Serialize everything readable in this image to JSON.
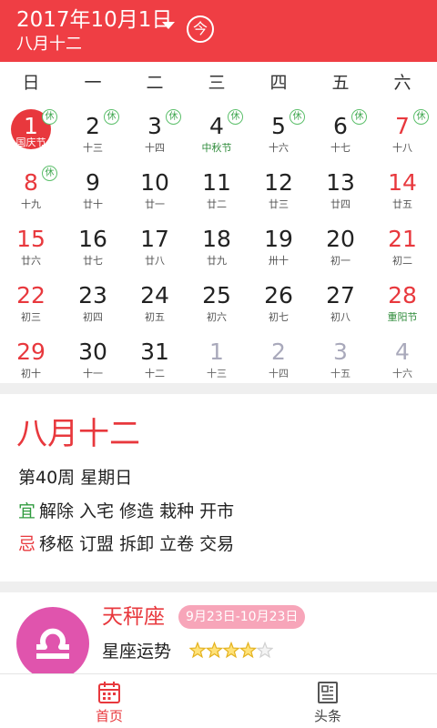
{
  "header": {
    "date": "2017年10月1日",
    "lunar": "八月十二",
    "today_label": "今",
    "color": "#ef3e44"
  },
  "weekdays": [
    "日",
    "一",
    "二",
    "三",
    "四",
    "五",
    "六"
  ],
  "rest_mark": "休",
  "days": [
    {
      "n": "1",
      "l": "国庆节",
      "rest": true,
      "weekend": true,
      "sel": true
    },
    {
      "n": "2",
      "l": "十三",
      "rest": true
    },
    {
      "n": "3",
      "l": "十四",
      "rest": true
    },
    {
      "n": "4",
      "l": "中秋节",
      "rest": true,
      "fest": true
    },
    {
      "n": "5",
      "l": "十六",
      "rest": true
    },
    {
      "n": "6",
      "l": "十七",
      "rest": true
    },
    {
      "n": "7",
      "l": "十八",
      "rest": true,
      "weekend": true
    },
    {
      "n": "8",
      "l": "十九",
      "rest": true,
      "weekend": true
    },
    {
      "n": "9",
      "l": "廿十"
    },
    {
      "n": "10",
      "l": "廿一"
    },
    {
      "n": "11",
      "l": "廿二"
    },
    {
      "n": "12",
      "l": "廿三"
    },
    {
      "n": "13",
      "l": "廿四"
    },
    {
      "n": "14",
      "l": "廿五",
      "weekend": true
    },
    {
      "n": "15",
      "l": "廿六",
      "weekend": true
    },
    {
      "n": "16",
      "l": "廿七"
    },
    {
      "n": "17",
      "l": "廿八"
    },
    {
      "n": "18",
      "l": "廿九"
    },
    {
      "n": "19",
      "l": "卅十"
    },
    {
      "n": "20",
      "l": "初一"
    },
    {
      "n": "21",
      "l": "初二",
      "weekend": true
    },
    {
      "n": "22",
      "l": "初三",
      "weekend": true
    },
    {
      "n": "23",
      "l": "初四"
    },
    {
      "n": "24",
      "l": "初五"
    },
    {
      "n": "25",
      "l": "初六"
    },
    {
      "n": "26",
      "l": "初七"
    },
    {
      "n": "27",
      "l": "初八"
    },
    {
      "n": "28",
      "l": "重阳节",
      "weekend": true,
      "fest": true
    },
    {
      "n": "29",
      "l": "初十",
      "weekend": true
    },
    {
      "n": "30",
      "l": "十一"
    },
    {
      "n": "31",
      "l": "十二"
    },
    {
      "n": "1",
      "l": "十三",
      "other": true
    },
    {
      "n": "2",
      "l": "十四",
      "other": true
    },
    {
      "n": "3",
      "l": "十五",
      "other": true
    },
    {
      "n": "4",
      "l": "十六",
      "other": true
    }
  ],
  "detail": {
    "lunar_title": "八月十二",
    "week_line": "第40周 星期日",
    "yi_tag": "宜",
    "yi_items": "解除 入宅 修造 栽种 开市",
    "ji_tag": "忌",
    "ji_items": "移柩 订盟 拆卸 立卷 交易"
  },
  "zodiac": {
    "sign": "天秤座",
    "range": "9月23日-10月23日",
    "fortune_label": "星座运势",
    "stars_filled": 4,
    "stars_total": 5,
    "icon": "libra-icon"
  },
  "nav": {
    "home": "首页",
    "headlines": "头条"
  }
}
